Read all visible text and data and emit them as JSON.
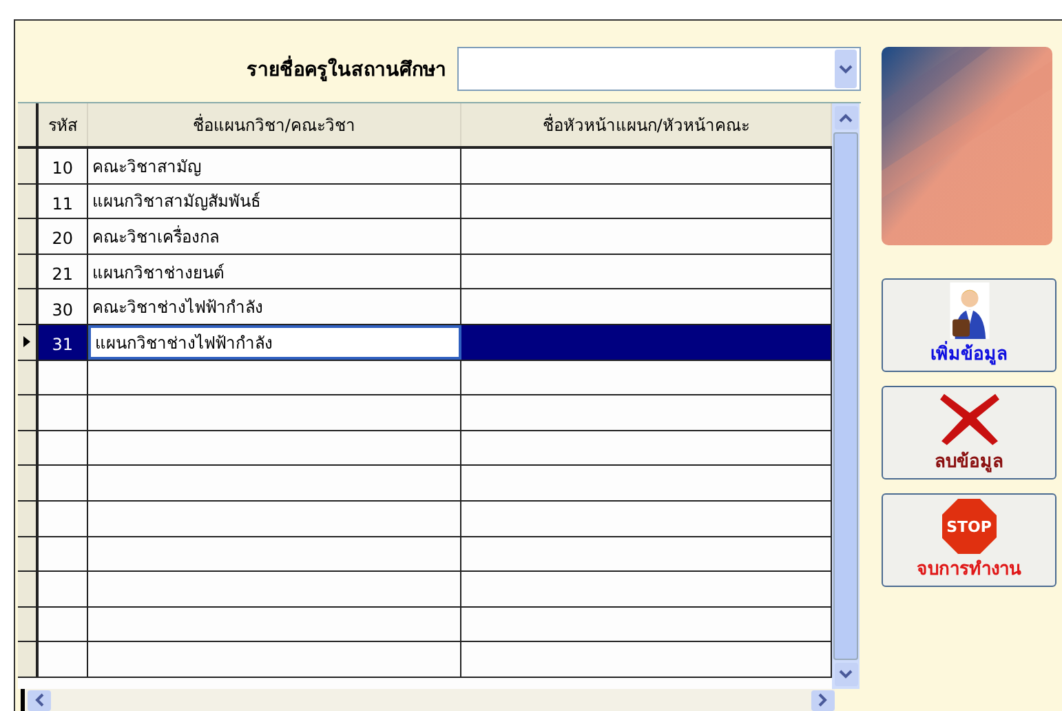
{
  "filter": {
    "label": "รายชื่อครูในสถานศึกษา"
  },
  "table": {
    "columns": [
      "รหัส",
      "ชื่อแผนกวิชา/คณะวิชา",
      "ชื่อหัวหน้าแผนก/หัวหน้าคณะ"
    ],
    "rows": [
      {
        "code": "10",
        "name": "คณะวิชาสามัญ",
        "selected": false
      },
      {
        "code": "11",
        "name": "แผนกวิชาสามัญสัมพันธ์",
        "selected": false
      },
      {
        "code": "20",
        "name": "คณะวิชาเครื่องกล",
        "selected": false
      },
      {
        "code": "21",
        "name": "แผนกวิชาช่างยนต์",
        "selected": false
      },
      {
        "code": "30",
        "name": "คณะวิชาช่างไฟฟ้ากำลัง",
        "selected": false
      },
      {
        "code": "31",
        "name": "แผนกวิชาช่างไฟฟ้ากำลัง",
        "selected": true
      }
    ]
  },
  "side": {
    "buttons": [
      {
        "kind": "add",
        "label": "เพิ่มข้อมูล"
      },
      {
        "kind": "delete",
        "label": "ลบข้อมูล"
      },
      {
        "kind": "stop",
        "label": "จบการทำงาน",
        "sign": "STOP"
      }
    ]
  }
}
